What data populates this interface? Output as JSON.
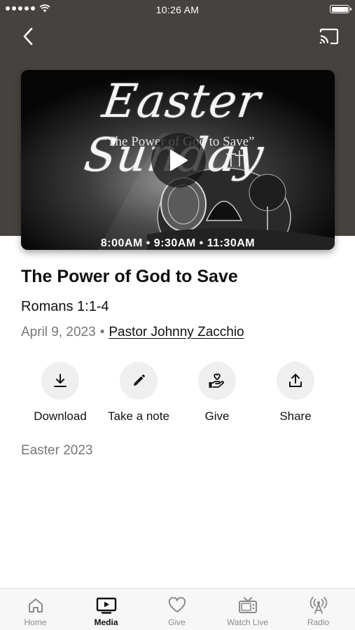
{
  "status_bar": {
    "time": "10:26 AM"
  },
  "nav": {
    "back_icon": "chevron-left-icon",
    "cast_icon": "cast-icon"
  },
  "video": {
    "art_title": "Easter Sunday",
    "art_quote": "“The Power of God to Save”",
    "art_times": "8:00AM • 9:30AM • 11:30AM",
    "play_icon": "play-icon"
  },
  "sermon": {
    "title": "The Power of God to Save",
    "scripture": "Romans 1:1-4",
    "date": "April 9, 2023",
    "separator": "•",
    "speaker": "Pastor Johnny Zacchio",
    "series": "Easter 2023"
  },
  "actions": [
    {
      "label": "Download",
      "icon": "download-icon"
    },
    {
      "label": "Take a note",
      "icon": "pencil-icon"
    },
    {
      "label": "Give",
      "icon": "give-hand-heart-icon"
    },
    {
      "label": "Share",
      "icon": "share-icon"
    }
  ],
  "tabs": [
    {
      "label": "Home",
      "icon": "home-icon",
      "active": false
    },
    {
      "label": "Media",
      "icon": "tv-play-icon",
      "active": true
    },
    {
      "label": "Give",
      "icon": "heart-icon",
      "active": false
    },
    {
      "label": "Watch Live",
      "icon": "tv-icon",
      "active": false
    },
    {
      "label": "Radio",
      "icon": "radio-antenna-icon",
      "active": false
    }
  ],
  "colors": {
    "header_bg": "#46423f",
    "action_circle": "#efefef",
    "muted_text": "#777777",
    "tab_inactive": "#8a8a8a"
  }
}
